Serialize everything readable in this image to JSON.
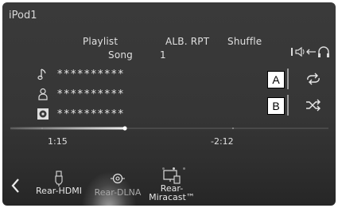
{
  "title": "iPod1",
  "modes": {
    "playlist": "Playlist",
    "alb_rpt": "ALB. RPT",
    "shuffle": "Shuffle",
    "song": "Song",
    "one": "1"
  },
  "track": {
    "song": "**********",
    "artist": "**********",
    "album": "**********"
  },
  "buttons": {
    "callout_a": "A",
    "callout_b": "B"
  },
  "progress": {
    "elapsed": "1:15",
    "remaining": "-2:12",
    "fraction": 0.36
  },
  "pager": {
    "pages": 3,
    "active": 1
  },
  "sources": [
    {
      "label_lines": [
        "Rear-HDMI"
      ],
      "icon": "usb-icon",
      "active": false
    },
    {
      "label_lines": [
        "Rear-DLNA"
      ],
      "icon": "dlna-icon",
      "active": true
    },
    {
      "label_lines": [
        "Rear-",
        "Miracast™"
      ],
      "icon": "miracast-icon",
      "active": false
    }
  ]
}
